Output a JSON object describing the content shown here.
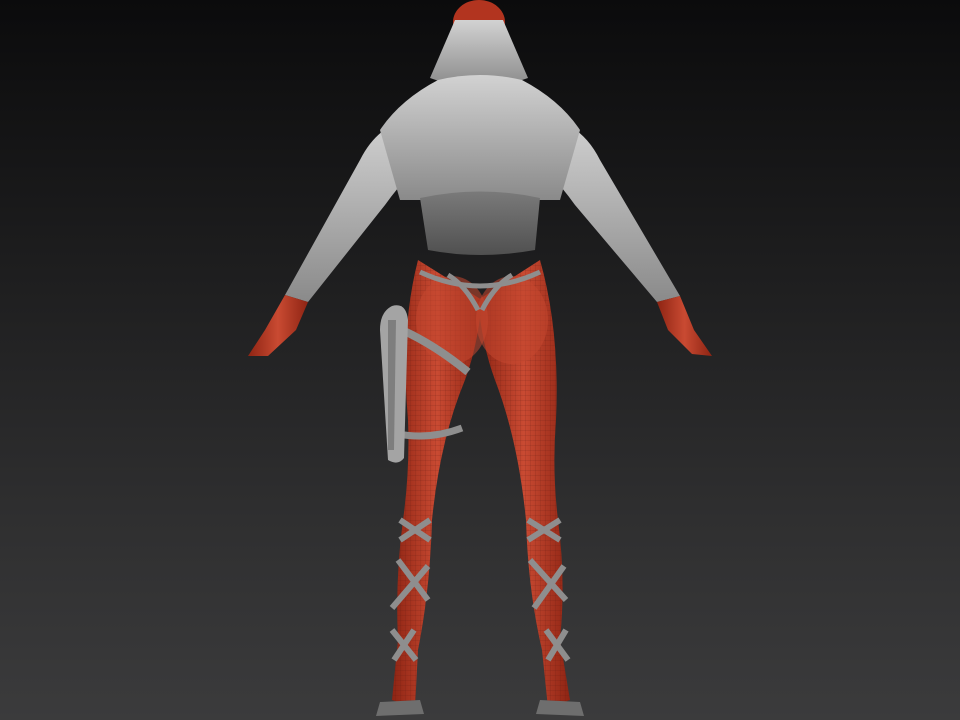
{
  "viewport": {
    "background_top": "#0b0b0c",
    "background_bottom": "#3b3b3c"
  },
  "model": {
    "skin_color": "#b8331f",
    "skin_highlight": "#d0533a",
    "cloth_color": "#b9b9b9",
    "cloth_shadow": "#6e6e6e",
    "strap_color": "#8e8e8e",
    "wireframe_color": "#5a1a12"
  }
}
